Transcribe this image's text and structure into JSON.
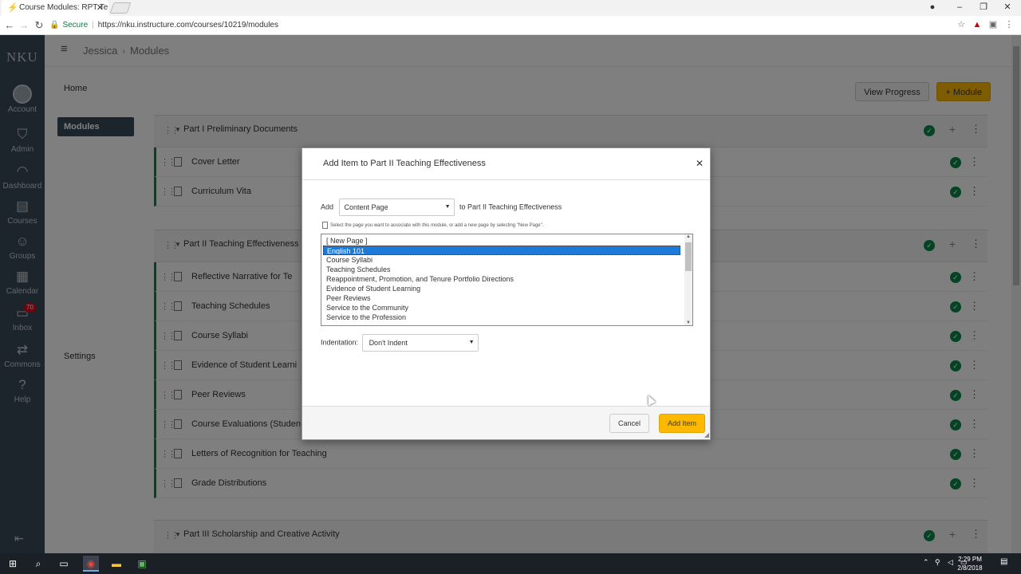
{
  "browser": {
    "tab_title": "Course Modules: RPT Te",
    "url_secure_label": "Secure",
    "url": "https://nku.instructure.com/courses/10219/modules"
  },
  "global_nav": {
    "logo": "NKU",
    "items": [
      {
        "label": "Account",
        "icon": "avatar"
      },
      {
        "label": "Admin",
        "icon": "shield-icon"
      },
      {
        "label": "Dashboard",
        "icon": "dashboard-icon"
      },
      {
        "label": "Courses",
        "icon": "book-icon"
      },
      {
        "label": "Groups",
        "icon": "groups-icon"
      },
      {
        "label": "Calendar",
        "icon": "calendar-icon"
      },
      {
        "label": "Inbox",
        "icon": "inbox-icon",
        "badge": "70"
      },
      {
        "label": "Commons",
        "icon": "commons-icon"
      },
      {
        "label": "Help",
        "icon": "help-icon"
      }
    ]
  },
  "breadcrumb": {
    "course": "Jessica",
    "page": "Modules"
  },
  "course_nav": {
    "home": "Home",
    "modules": "Modules",
    "settings": "Settings"
  },
  "module_buttons": {
    "view_progress": "View Progress",
    "add_module": "+ Module"
  },
  "modules": {
    "part1": {
      "title": "Part I Preliminary Documents",
      "items": [
        "Cover Letter",
        "Curriculum Vita"
      ]
    },
    "part2": {
      "title": "Part II Teaching Effectiveness",
      "items": [
        "Reflective Narrative for Te",
        "Teaching Schedules",
        "Course Syllabi",
        "Evidence of Student Learni",
        "Peer Reviews",
        "Course Evaluations (Studen",
        "Letters of Recognition for Teaching",
        "Grade Distributions"
      ]
    },
    "part3": {
      "title": "Part III Scholarship and Creative Activity"
    }
  },
  "dialog": {
    "title": "Add Item to Part II Teaching Effectiveness",
    "add_label": "Add",
    "item_type": "Content Page",
    "to_label": "to Part II Teaching Effectiveness",
    "hint": "Select the page you want to associate with this module, or add a new page by selecting \"New Page\".",
    "options": [
      "[ New Page ]",
      "English 101",
      "Course Syllabi",
      "Teaching Schedules",
      "Reappointment, Promotion, and Tenure Portfolio Directions",
      "Evidence of Student Learning",
      "Peer Reviews",
      "Service to the Community",
      "Service to the Profession"
    ],
    "selected_index": 1,
    "indentation_label": "Indentation:",
    "indentation_value": "Don't Indent",
    "cancel": "Cancel",
    "add_item": "Add Item"
  },
  "taskbar": {
    "time": "2:29 PM",
    "date": "2/8/2018"
  },
  "colors": {
    "nav_bg": "#394b58",
    "accent": "#fcb900",
    "published": "#0b874b",
    "selection": "#1e7ad8"
  }
}
